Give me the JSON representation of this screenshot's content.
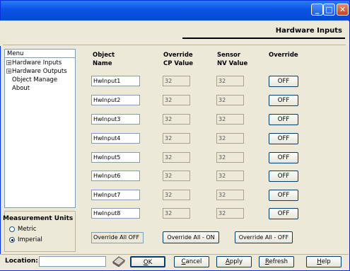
{
  "window": {
    "title": "",
    "controls": {
      "minimize": "_",
      "maximize": "□",
      "close": "✕"
    }
  },
  "header": {
    "title": "Hardware Inputs"
  },
  "menu": {
    "header": "Menu",
    "items": [
      {
        "label": "Hardware Inputs",
        "expandable": true,
        "expander": "+"
      },
      {
        "label": "Hardware Outputs",
        "expandable": true,
        "expander": "+"
      },
      {
        "label": "Object Manage",
        "expandable": false
      },
      {
        "label": "About",
        "expandable": false
      }
    ]
  },
  "measurement_units": {
    "title": "Measurement Units",
    "options": [
      {
        "label": "Metric",
        "selected": false
      },
      {
        "label": "Imperial",
        "selected": true
      }
    ]
  },
  "table": {
    "headers": {
      "object_name_1": "Object",
      "object_name_2": "Name",
      "cp_1": "Override",
      "cp_2": "CP Value",
      "nv_1": "Sensor",
      "nv_2": "NV Value",
      "override": "Override"
    },
    "rows": [
      {
        "name": "HwInput1",
        "cp_value": "32",
        "nv_value": "32",
        "override": "OFF"
      },
      {
        "name": "HwInput2",
        "cp_value": "32",
        "nv_value": "32",
        "override": "OFF"
      },
      {
        "name": "HwInput3",
        "cp_value": "32",
        "nv_value": "32",
        "override": "OFF"
      },
      {
        "name": "HwInput4",
        "cp_value": "32",
        "nv_value": "32",
        "override": "OFF"
      },
      {
        "name": "HwInput5",
        "cp_value": "32",
        "nv_value": "32",
        "override": "OFF"
      },
      {
        "name": "HwInput6",
        "cp_value": "32",
        "nv_value": "32",
        "override": "OFF"
      },
      {
        "name": "HwInput7",
        "cp_value": "32",
        "nv_value": "32",
        "override": "OFF"
      },
      {
        "name": "HwInput8",
        "cp_value": "32",
        "nv_value": "32",
        "override": "OFF"
      }
    ]
  },
  "override_all": {
    "status": "Override All OFF",
    "on_button": "Override All - ON",
    "off_button": "Override All - OFF"
  },
  "bottom_bar": {
    "location_label": "Location:",
    "location_value": "",
    "eraser_icon": "eraser-icon",
    "buttons": {
      "ok": {
        "accel": "O",
        "rest": "K"
      },
      "cancel": {
        "accel": "C",
        "rest": "ancel"
      },
      "apply": {
        "accel": "A",
        "rest": "pply"
      },
      "refresh": {
        "accel": "R",
        "rest": "efresh"
      },
      "help": {
        "accel": "H",
        "rest": "elp"
      }
    }
  },
  "colors": {
    "titlebar": "#0a55e6",
    "window_bg": "#ece9d8",
    "border": "#7f9db9"
  }
}
